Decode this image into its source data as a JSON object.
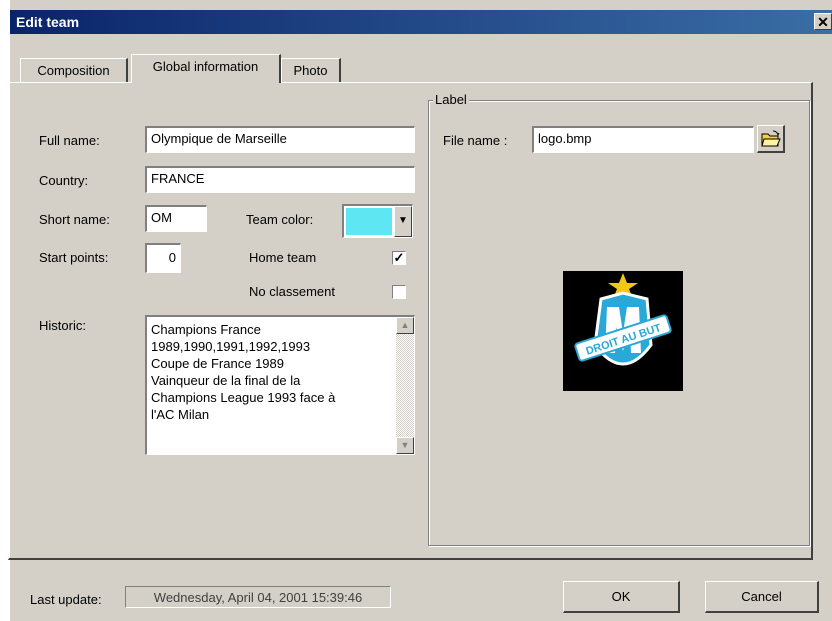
{
  "window": {
    "title": "Edit team",
    "close_glyph": "✕"
  },
  "tabs": [
    {
      "label": "Composition",
      "active": false
    },
    {
      "label": "Global information",
      "active": true
    },
    {
      "label": "Photo",
      "active": false
    }
  ],
  "form": {
    "full_name_label": "Full name:",
    "full_name_value": "Olympique de Marseille",
    "country_label": "Country:",
    "country_value": "FRANCE",
    "short_name_label": "Short name:",
    "short_name_value": "OM",
    "team_color_label": "Team color:",
    "team_color_value": "#5ee6f2",
    "start_points_label": "Start points:",
    "start_points_value": "0",
    "home_team_label": "Home team",
    "home_team_checked": true,
    "no_classement_label": "No classement",
    "no_classement_checked": false,
    "historic_label": "Historic:",
    "historic_value": "Champions France\n1989,1990,1991,1992,1993\nCoupe de France 1989\nVainqueur de la final de la\nChampions League 1993 face à\nl'AC Milan"
  },
  "label_group": {
    "title": "Label",
    "file_name_label": "File name :",
    "file_name_value": "logo.bmp",
    "browse_icon": "folder-open-icon",
    "logo_text": "DROIT AU BUT"
  },
  "footer": {
    "last_update_label": "Last update:",
    "last_update_value": "Wednesday, April 04, 2001 15:39:46",
    "ok_label": "OK",
    "cancel_label": "Cancel"
  }
}
